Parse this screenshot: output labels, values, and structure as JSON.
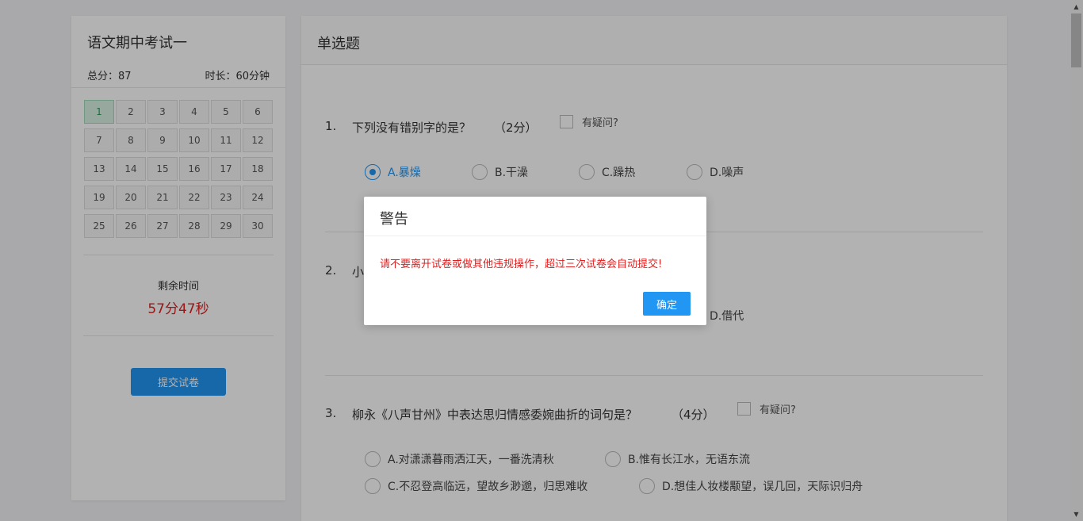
{
  "sidebar": {
    "exam_title": "语文期中考试一",
    "total_score": "总分：87",
    "duration": "时长：60分钟",
    "question_numbers": [
      "1",
      "2",
      "3",
      "4",
      "5",
      "6",
      "7",
      "8",
      "9",
      "10",
      "11",
      "12",
      "13",
      "14",
      "15",
      "16",
      "17",
      "18",
      "19",
      "20",
      "21",
      "22",
      "23",
      "24",
      "25",
      "26",
      "27",
      "28",
      "29",
      "30"
    ],
    "current_question": "1",
    "remaining_label": "剩余时间",
    "remaining_time": "57分47秒",
    "submit_label": "提交试卷"
  },
  "main": {
    "section_title": "单选题",
    "doubt_label": "有疑问?",
    "questions": [
      {
        "num": "1.",
        "text": "下列没有错别字的是？",
        "score": "（2分）",
        "options": [
          "A.暴燥",
          "B.干澡",
          "C.躁热",
          "D.噪声"
        ],
        "selected": "A.暴燥"
      },
      {
        "num": "2.",
        "text": "小",
        "options_visible": [
          "D.借代"
        ]
      },
      {
        "num": "3.",
        "text": "柳永《八声甘州》中表达思归情感委婉曲折的词句是？",
        "score": "（4分）",
        "options": [
          "A.对潇潇暮雨洒江天，一番洗清秋",
          "B.惟有长江水，无语东流",
          "C.不忍登高临远，望故乡渺邈，归思难收",
          "D.想佳人妆楼颙望，误几回，天际识归舟"
        ]
      }
    ]
  },
  "modal": {
    "title": "警告",
    "message": "请不要离开试卷或做其他违规操作，超过三次试卷会自动提交!",
    "ok_label": "确定"
  },
  "colors": {
    "accent": "#2196f3",
    "warning_text": "#e02020",
    "current_cell": "#d9f3e4"
  }
}
